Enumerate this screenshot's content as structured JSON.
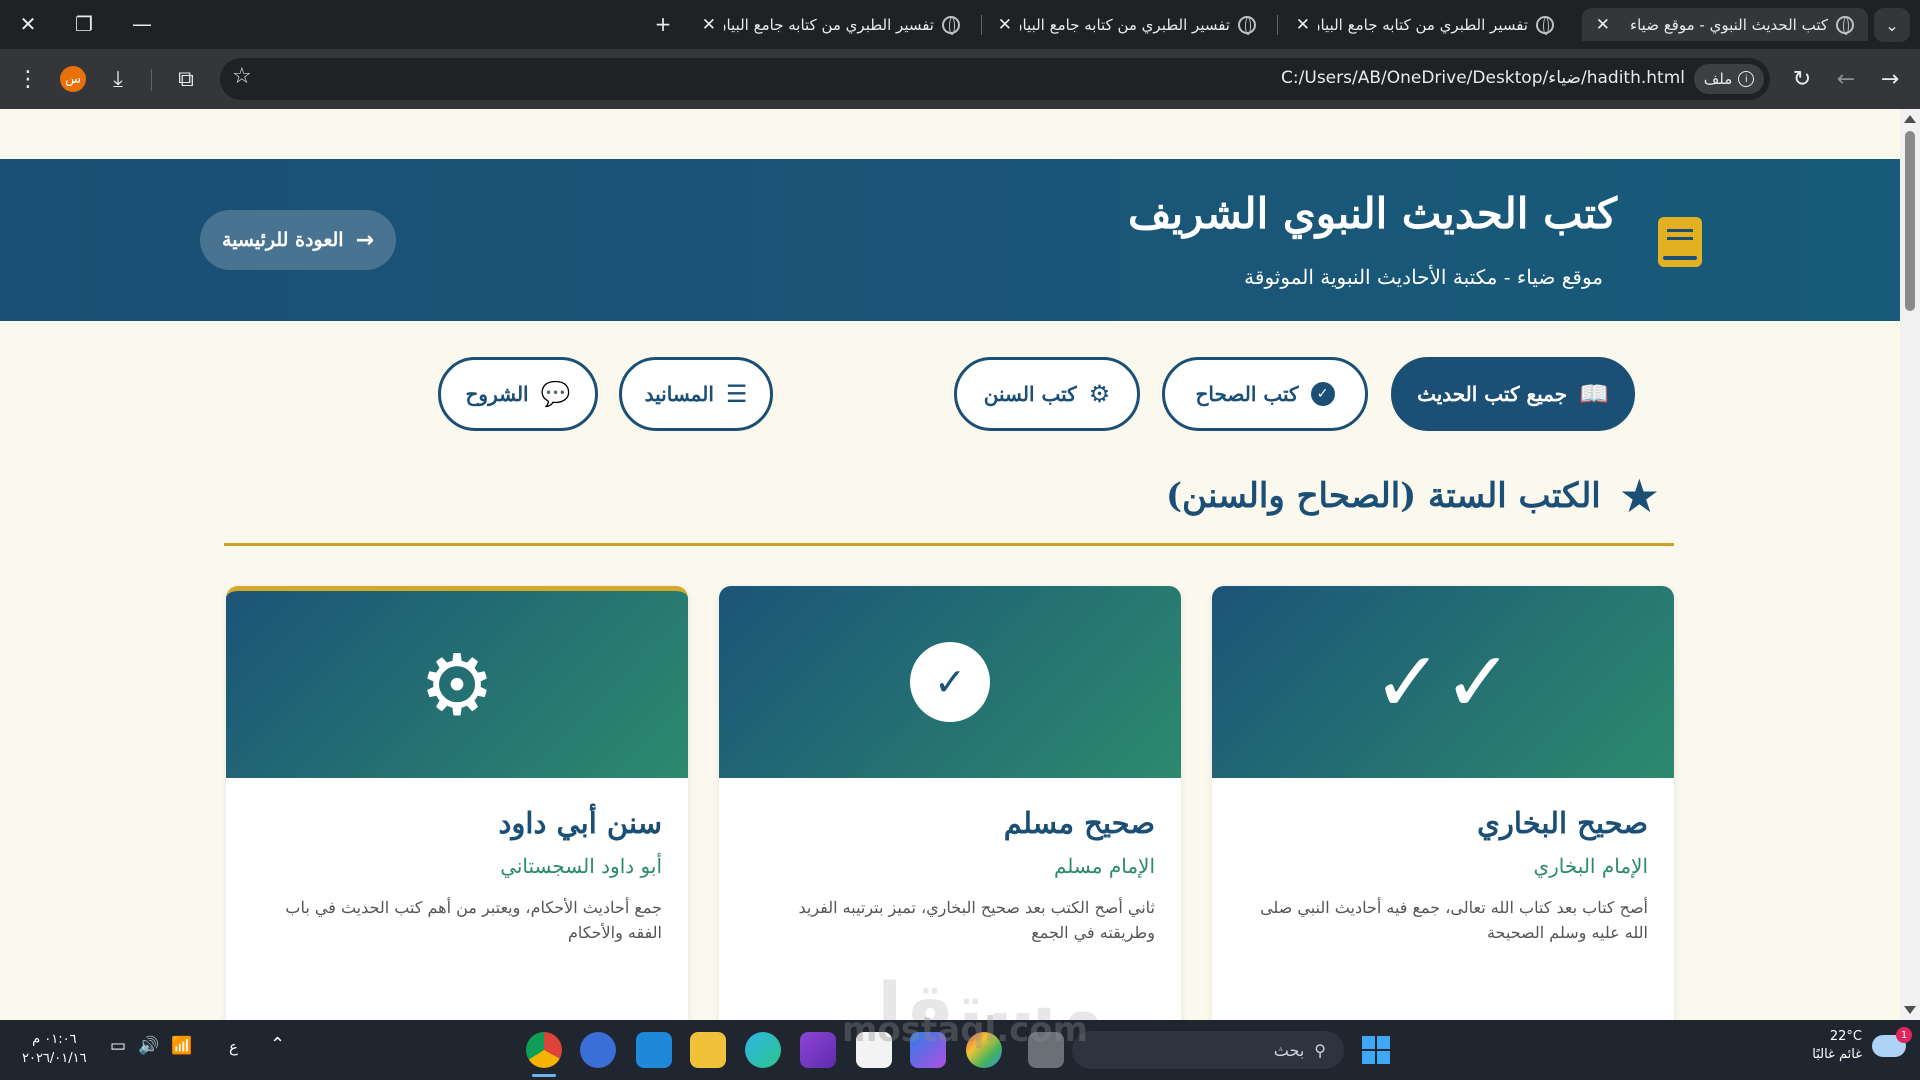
{
  "browser": {
    "tabs": [
      {
        "title": "كتب الحديث النبوي - موقع ضياء",
        "active": true
      },
      {
        "title": "تفسير الطبري من كتابه جامع البيان",
        "active": false
      },
      {
        "title": "تفسير الطبري من كتابه جامع البيان",
        "active": false
      },
      {
        "title": "تفسير الطبري من كتابه جامع البيان",
        "active": false
      }
    ],
    "new_tab": "+",
    "address": {
      "chip_label": "ملف",
      "url": "C:/Users/AB/OneDrive/Desktop/ضياء/hadith.html"
    },
    "profile_initial": "س"
  },
  "header": {
    "title": "كتب الحديث النبوي الشريف",
    "subtitle": "موقع ضياء - مكتبة الأحاديث النبوية الموثوقة",
    "back_label": "العودة للرئيسية"
  },
  "filters": [
    {
      "label": "جميع كتب الحديث",
      "icon": "open-book-icon",
      "active": true
    },
    {
      "label": "كتب الصحاح",
      "icon": "check-circle-icon",
      "active": false
    },
    {
      "label": "كتب السنن",
      "icon": "gear-icon",
      "active": false
    },
    {
      "label": "المسانيد",
      "icon": "list-icon",
      "active": false
    },
    {
      "label": "الشروح",
      "icon": "comments-icon",
      "active": false
    }
  ],
  "section": {
    "title": "الكتب الستة (الصحاح والسنن)"
  },
  "cards": [
    {
      "title": "صحيح البخاري",
      "author": "الإمام البخاري",
      "desc": "أصح كتاب بعد كتاب الله تعالى، جمع فيه أحاديث النبي صلى الله عليه وسلم الصحيحة",
      "icon": "double-check-icon"
    },
    {
      "title": "صحيح مسلم",
      "author": "الإمام مسلم",
      "desc": "ثاني أصح الكتب بعد صحيح البخاري، تميز بترتيبه الفريد وطريقته في الجمع",
      "icon": "check-circle-icon"
    },
    {
      "title": "سنن أبي داود",
      "author": "أبو داود السجستاني",
      "desc": "جمع أحاديث الأحكام، ويعتبر من أهم كتب الحديث في باب الفقه والأحكام",
      "icon": "gear-icon"
    }
  ],
  "watermark": {
    "text": "مستقل",
    "sub": "mostaql.com"
  },
  "taskbar": {
    "weather_temp": "22°C",
    "weather_desc": "غائم غالبًا",
    "weather_badge": "1",
    "search_placeholder": "بحث",
    "lang": "ع",
    "time": "٠١:٠٦ م",
    "date": "٢٠٢٦/٠١/١٦"
  },
  "colors": {
    "primary": "#1b4f75",
    "accent_gold": "#c9a227",
    "accent_green": "#2c8a6d",
    "page_bg": "#fbf8ee"
  }
}
